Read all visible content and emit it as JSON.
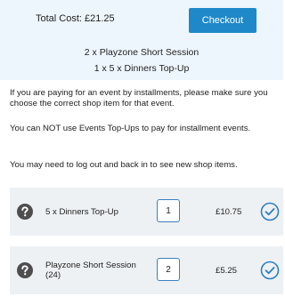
{
  "summary": {
    "total_label": "Total Cost: £21.25",
    "checkout_label": "Checkout",
    "cart_lines": [
      "2 x Playzone Short Session",
      "1 x 5 x Dinners Top-Up"
    ]
  },
  "notices": [
    "If you are paying for an event by installments, please make sure you choose the correct shop item for that event.",
    "You can NOT use Events Top-Ups to pay for installment events.",
    "You may need to log out and back in to see new shop items."
  ],
  "items": [
    {
      "name": "5 x Dinners Top-Up",
      "quantity": "1",
      "price": "£10.75",
      "icon": "question-circle-icon",
      "status_icon": "check-circle-icon"
    },
    {
      "name": "Playzone Short Session (24)",
      "quantity": "2",
      "price": "£5.25",
      "icon": "question-circle-icon",
      "status_icon": "check-circle-icon"
    }
  ],
  "colors": {
    "accent": "#1f88c9",
    "summary_bg": "#eef6fd",
    "card_bg": "#eef1f4",
    "help_icon": "#4e4e4e",
    "check_icon": "#2d7ec4"
  }
}
